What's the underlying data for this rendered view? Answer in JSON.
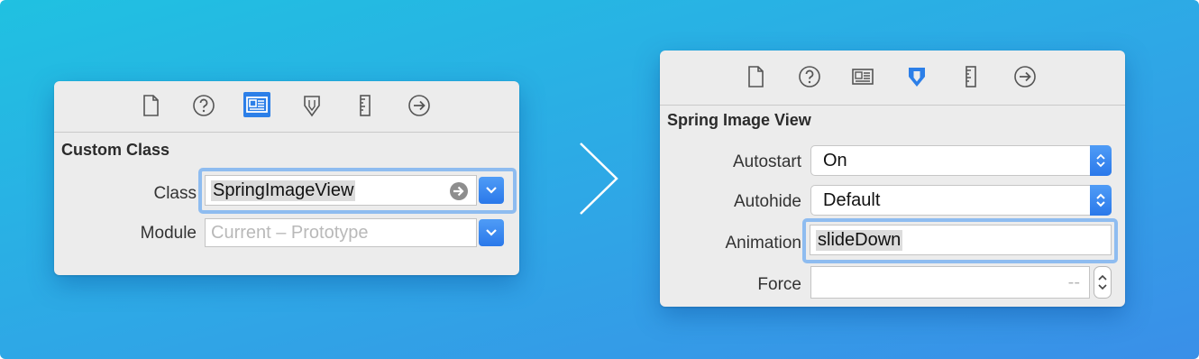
{
  "left_panel": {
    "toolbar_icons": [
      "file-icon",
      "help-icon",
      "identity-icon",
      "attributes-icon",
      "size-ruler-icon",
      "connections-icon"
    ],
    "selected_icon": "identity-icon",
    "section_title": "Custom Class",
    "class_label": "Class",
    "class_value": "SpringImageView",
    "module_label": "Module",
    "module_placeholder": "Current – Prototype"
  },
  "right_panel": {
    "toolbar_icons": [
      "file-icon",
      "help-icon",
      "identity-icon",
      "attributes-icon",
      "size-ruler-icon",
      "connections-icon"
    ],
    "selected_icon": "attributes-icon",
    "section_title": "Spring Image View",
    "autostart_label": "Autostart",
    "autostart_value": "On",
    "autohide_label": "Autohide",
    "autohide_value": "Default",
    "animation_label": "Animation",
    "animation_value": "slideDown",
    "force_label": "Force",
    "force_placeholder": "--"
  },
  "colors": {
    "background_top": "#20c1e1",
    "background_bottom": "#3a8fe8",
    "accent_blue": "#2c7fe8",
    "focus_ring": "#8ebcf0",
    "panel": "#ececec"
  }
}
